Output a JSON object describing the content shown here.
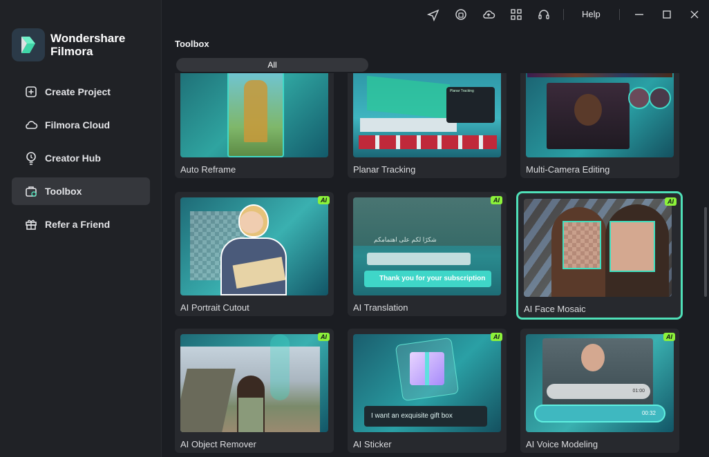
{
  "brand": {
    "line1": "Wondershare",
    "line2": "Filmora"
  },
  "nav": [
    {
      "label": "Create Project",
      "icon": "plus-square-icon"
    },
    {
      "label": "Filmora Cloud",
      "icon": "cloud-icon"
    },
    {
      "label": "Creator Hub",
      "icon": "bulb-icon"
    },
    {
      "label": "Toolbox",
      "icon": "toolbox-icon",
      "active": true
    },
    {
      "label": "Refer a Friend",
      "icon": "gift-icon"
    }
  ],
  "topbar": {
    "help": "Help"
  },
  "section": {
    "title": "Toolbox",
    "filter": "All"
  },
  "ai_badge": "AI",
  "tools": [
    {
      "label": "Auto Reframe"
    },
    {
      "label": "Planar Tracking",
      "thumb_text": "Planar Tracking"
    },
    {
      "label": "Multi-Camera Editing"
    },
    {
      "label": "AI Portrait Cutout"
    },
    {
      "label": "AI Translation",
      "thumb_text": "Thank you for your subscription",
      "thumb_arabic": "شكرًا لكم على اهتمامكم"
    },
    {
      "label": "AI Face Mosaic",
      "selected": true
    },
    {
      "label": "AI Object Remover"
    },
    {
      "label": "AI Sticker",
      "thumb_text": "I want an exquisite gift box"
    },
    {
      "label": "AI Voice Modeling",
      "time1": "01:00",
      "time2": "00:32"
    }
  ],
  "colors": {
    "accent": "#4fe0b8",
    "ai_badge": "#8cf23a",
    "sidebar": "#202226",
    "active_item": "#35373c"
  }
}
